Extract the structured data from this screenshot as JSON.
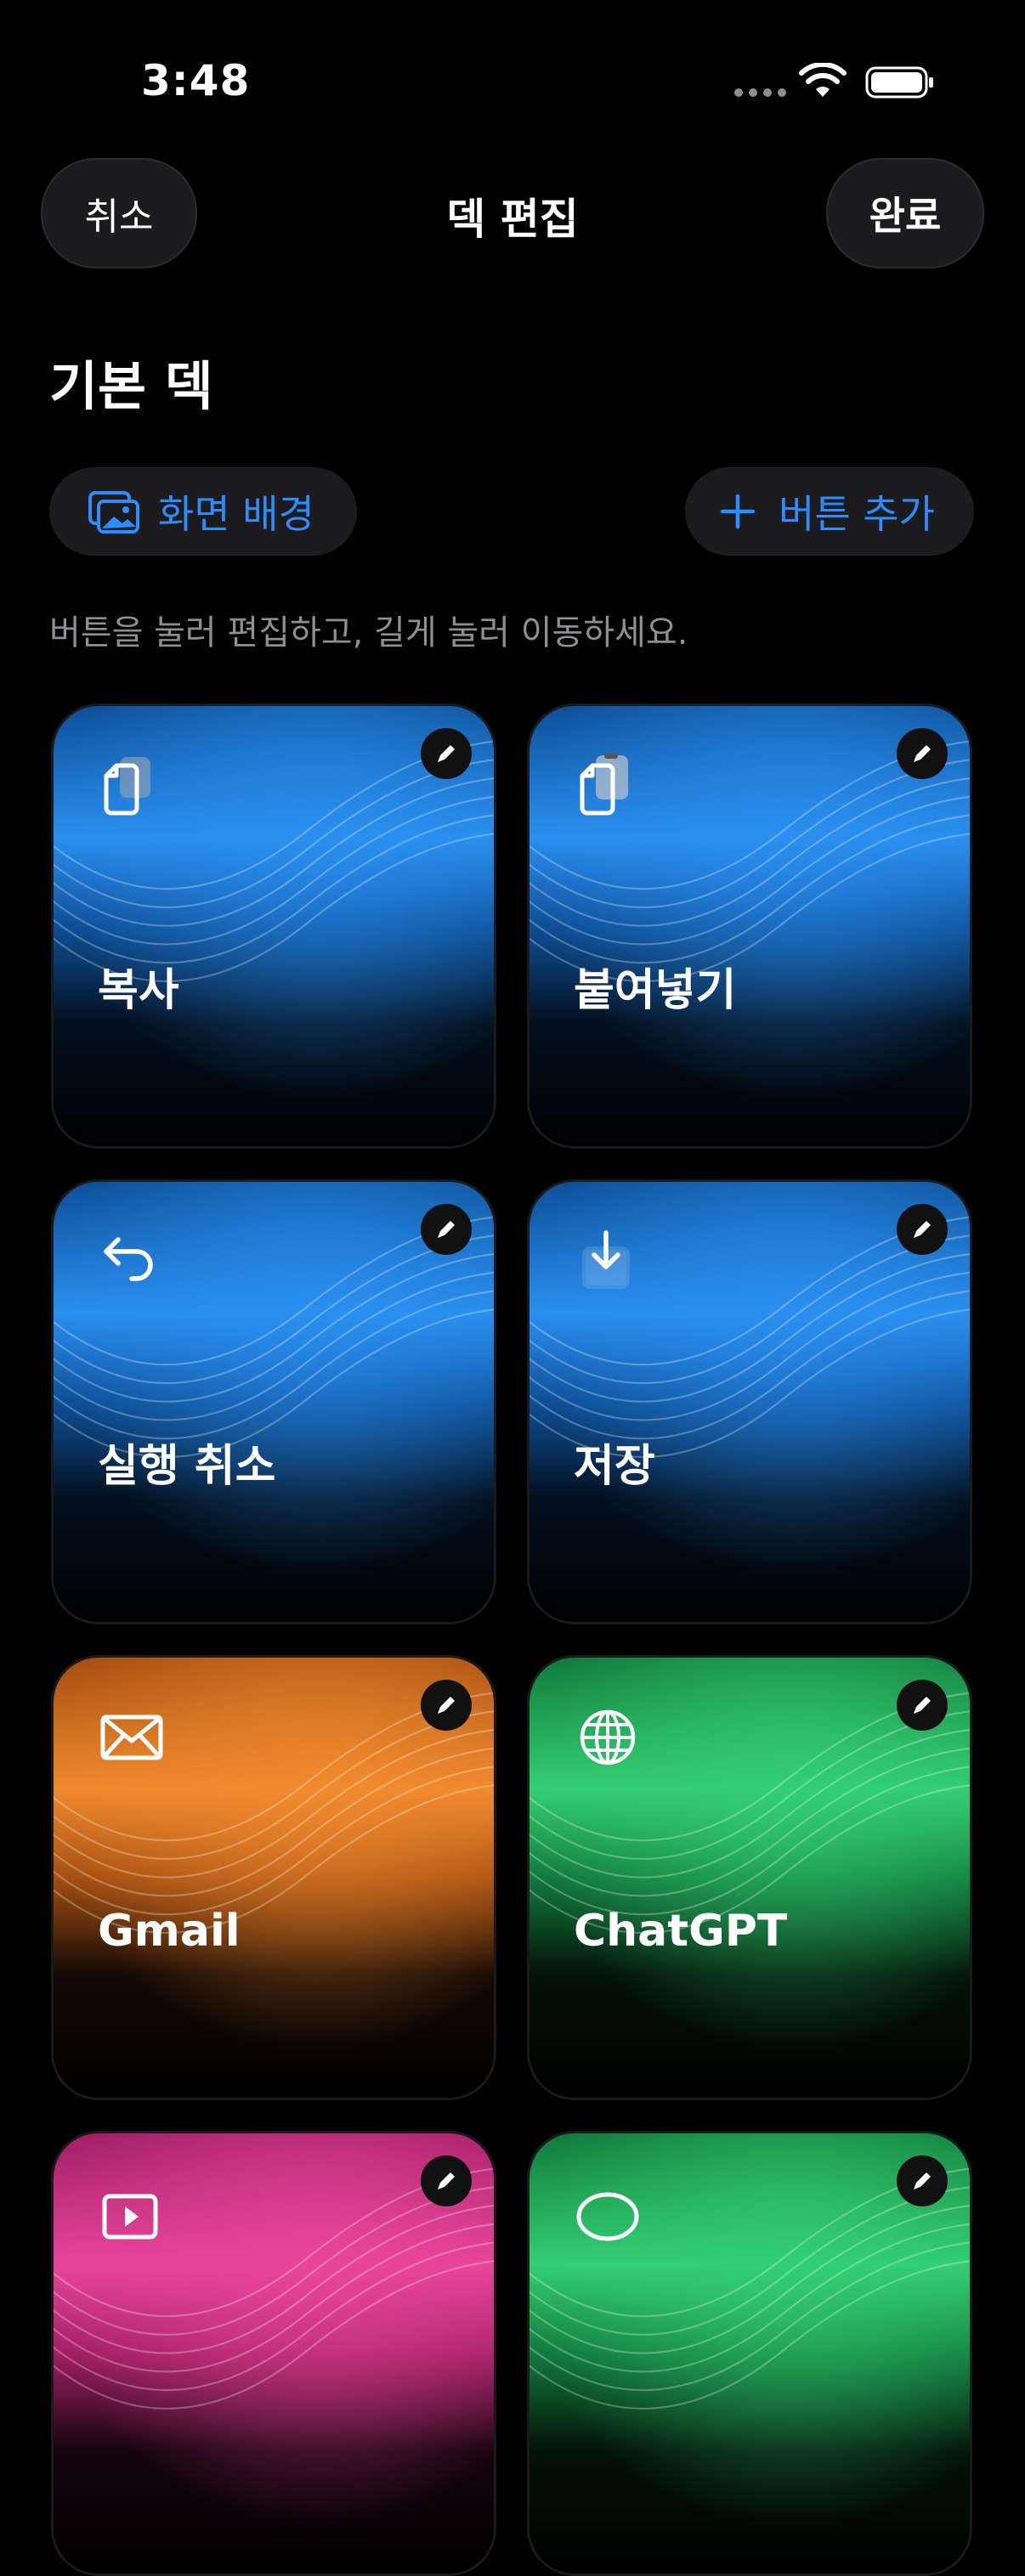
{
  "status_bar": {
    "time": "3:48"
  },
  "nav": {
    "cancel_label": "취소",
    "title": "덱 편집",
    "done_label": "완료"
  },
  "section": {
    "title": "기본 덱"
  },
  "actions": {
    "background_label": "화면 배경",
    "add_button_label": "버튼 추가"
  },
  "hint": "버튼을 눌러 편집하고, 길게 눌러 이동하세요.",
  "colors": {
    "accent": "#2d8cff",
    "blue_card": "#1e7fd8",
    "orange_card": "#e87a26",
    "green_card": "#2bbf66",
    "pink_card": "#d63a8a"
  },
  "cards": [
    {
      "label": "복사",
      "icon": "copy-icon",
      "theme": "blue"
    },
    {
      "label": "붙여넣기",
      "icon": "paste-icon",
      "theme": "blue"
    },
    {
      "label": "실행 취소",
      "icon": "undo-icon",
      "theme": "blue"
    },
    {
      "label": "저장",
      "icon": "save-icon",
      "theme": "blue"
    },
    {
      "label": "Gmail",
      "icon": "mail-icon",
      "theme": "orange"
    },
    {
      "label": "ChatGPT",
      "icon": "globe-icon",
      "theme": "green"
    },
    {
      "label": "",
      "icon": "play-icon",
      "theme": "pink"
    },
    {
      "label": "",
      "icon": "chat-bubble-icon",
      "theme": "green"
    }
  ]
}
